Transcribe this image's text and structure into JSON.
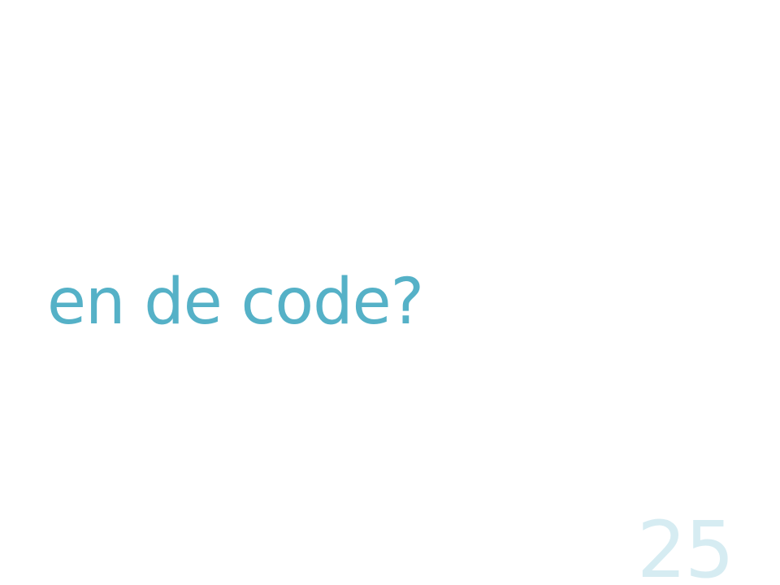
{
  "slide": {
    "title": "en de code?",
    "page_number": "25"
  },
  "colors": {
    "title": "#55b1c7",
    "page_number": "#d6ecf2",
    "background": "#ffffff"
  }
}
